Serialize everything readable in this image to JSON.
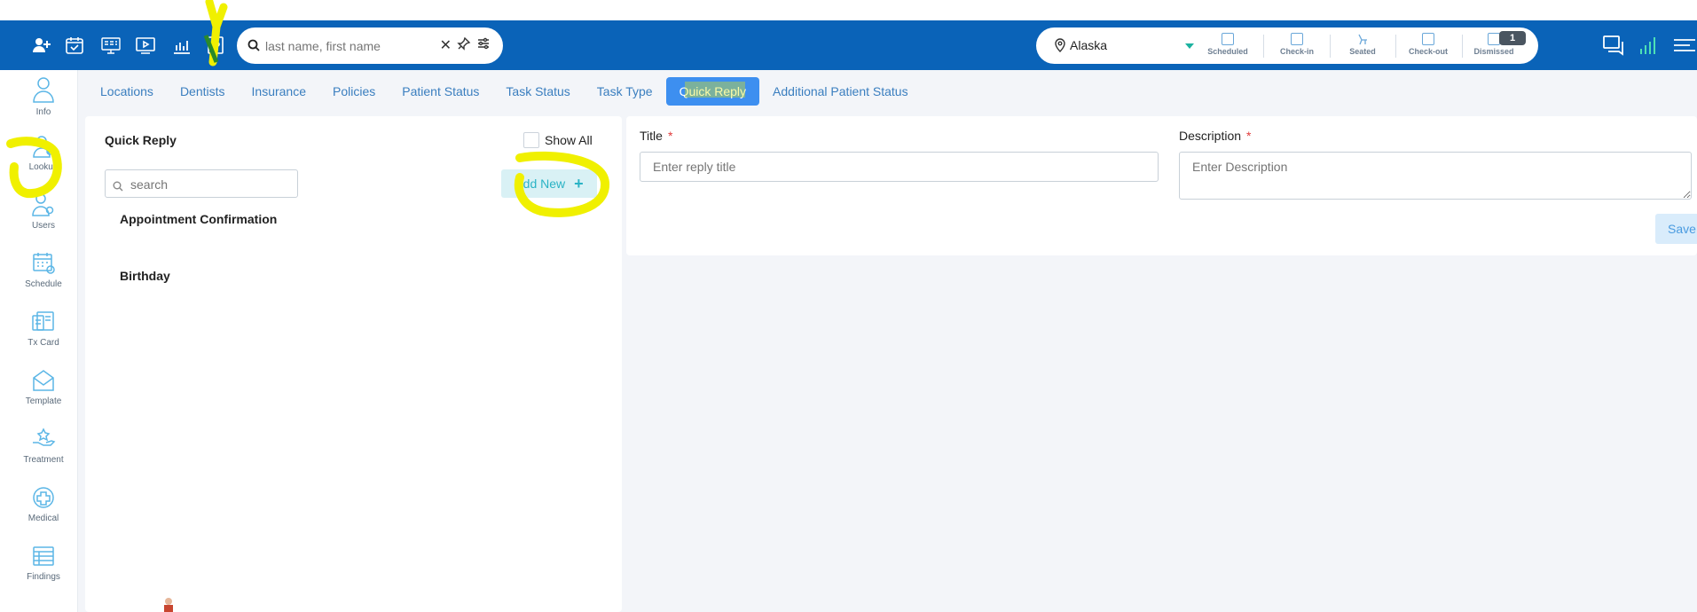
{
  "topbar": {
    "search_placeholder": "last name, first name",
    "location": "Alaska",
    "statuses": [
      {
        "label": "Scheduled"
      },
      {
        "label": "Check-in"
      },
      {
        "label": "Seated"
      },
      {
        "label": "Check-out"
      },
      {
        "label": "Dismissed"
      }
    ],
    "dismissed_badge": "1",
    "bar_color": "#0a63b8"
  },
  "sidebar": {
    "items": [
      {
        "label": "Info",
        "icon": "person-icon"
      },
      {
        "label": "Lookup",
        "icon": "lookup-icon"
      },
      {
        "label": "Users",
        "icon": "users-icon"
      },
      {
        "label": "Schedule",
        "icon": "schedule-icon"
      },
      {
        "label": "Tx Card",
        "icon": "tx-card-icon"
      },
      {
        "label": "Template",
        "icon": "template-icon"
      },
      {
        "label": "Treatment",
        "icon": "treatment-icon"
      },
      {
        "label": "Medical",
        "icon": "medical-icon"
      },
      {
        "label": "Findings",
        "icon": "findings-icon"
      }
    ]
  },
  "tabs": [
    {
      "label": "Locations"
    },
    {
      "label": "Dentists"
    },
    {
      "label": "Insurance"
    },
    {
      "label": "Policies"
    },
    {
      "label": "Patient Status"
    },
    {
      "label": "Task Status"
    },
    {
      "label": "Task Type"
    },
    {
      "label": "Quick Reply"
    },
    {
      "label": "Additional Patient Status"
    }
  ],
  "active_tab": "Quick Reply",
  "left_panel": {
    "title": "Quick Reply",
    "show_all_label": "Show All",
    "search_placeholder": "search",
    "add_new_label": "Add New",
    "add_new_plus": "+",
    "replies": [
      {
        "title": "Appointment Confirmation"
      },
      {
        "title": "Birthday"
      }
    ]
  },
  "form": {
    "title_label": "Title",
    "title_placeholder": "Enter reply title",
    "description_label": "Description",
    "description_placeholder": "Enter Description",
    "required_mark": "*",
    "save_label": "Save"
  }
}
